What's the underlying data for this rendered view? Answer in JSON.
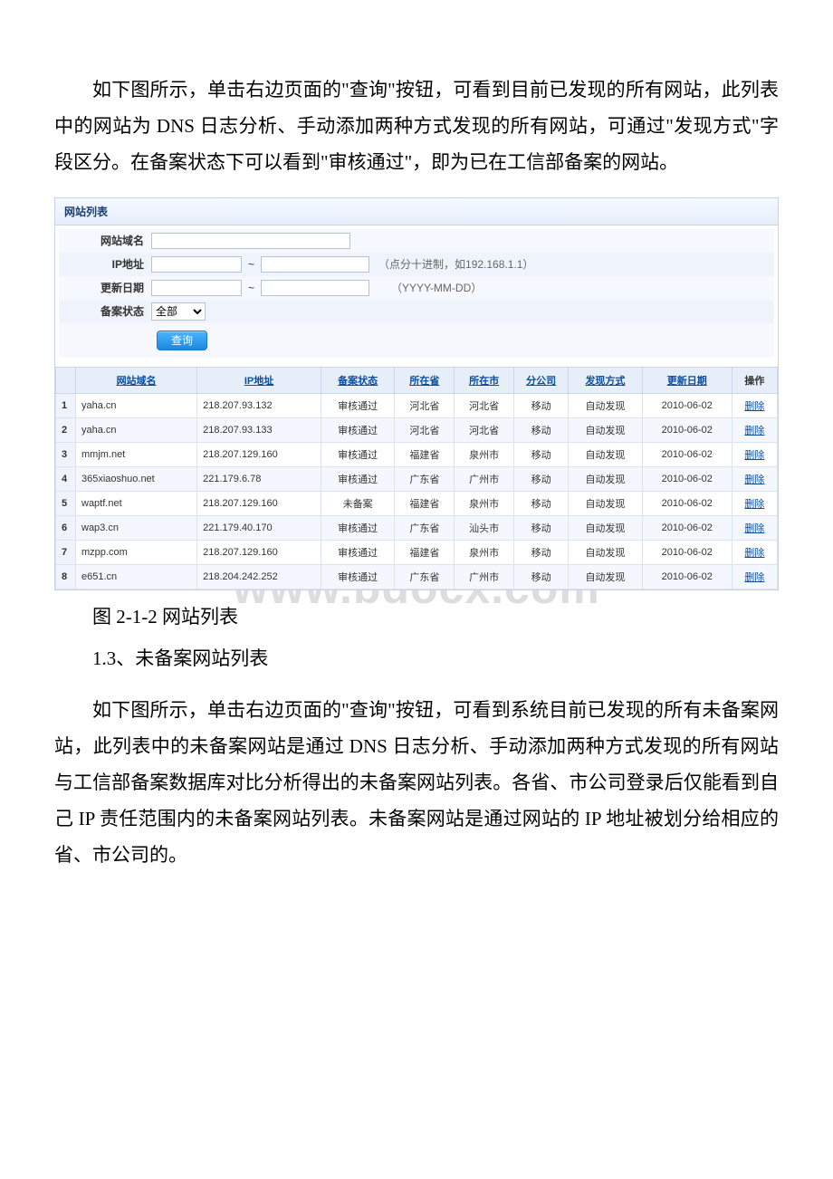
{
  "watermark": "www.bdocx.com",
  "para1": "如下图所示，单击右边页面的\"查询\"按钮，可看到目前已发现的所有网站，此列表中的网站为 DNS 日志分析、手动添加两种方式发现的所有网站，可通过\"发现方式\"字段区分。在备案状态下可以看到\"审核通过\"，即为已在工信部备案的网站。",
  "panel": {
    "title": "网站列表",
    "labels": {
      "domain": "网站域名",
      "ip": "IP地址",
      "date": "更新日期",
      "status": "备案状态"
    },
    "status_selected": "全部",
    "hints": {
      "ip": "（点分十进制，如192.168.1.1）",
      "date": "（YYYY-MM-DD）"
    },
    "search_btn": "查询"
  },
  "table": {
    "headers": {
      "domain": "网站域名",
      "ip": "IP地址",
      "status": "备案状态",
      "province": "所在省",
      "city": "所在市",
      "branch": "分公司",
      "method": "发现方式",
      "date": "更新日期",
      "op": "操作"
    },
    "rows": [
      {
        "idx": "1",
        "domain": "yaha.cn",
        "ip": "218.207.93.132",
        "status": "审核通过",
        "province": "河北省",
        "city": "河北省",
        "branch": "移动",
        "method": "自动发现",
        "date": "2010-06-02",
        "op": "删除"
      },
      {
        "idx": "2",
        "domain": "yaha.cn",
        "ip": "218.207.93.133",
        "status": "审核通过",
        "province": "河北省",
        "city": "河北省",
        "branch": "移动",
        "method": "自动发现",
        "date": "2010-06-02",
        "op": "删除"
      },
      {
        "idx": "3",
        "domain": "mmjm.net",
        "ip": "218.207.129.160",
        "status": "审核通过",
        "province": "福建省",
        "city": "泉州市",
        "branch": "移动",
        "method": "自动发现",
        "date": "2010-06-02",
        "op": "删除"
      },
      {
        "idx": "4",
        "domain": "365xiaoshuo.net",
        "ip": "221.179.6.78",
        "status": "审核通过",
        "province": "广东省",
        "city": "广州市",
        "branch": "移动",
        "method": "自动发现",
        "date": "2010-06-02",
        "op": "删除"
      },
      {
        "idx": "5",
        "domain": "waptf.net",
        "ip": "218.207.129.160",
        "status": "未备案",
        "province": "福建省",
        "city": "泉州市",
        "branch": "移动",
        "method": "自动发现",
        "date": "2010-06-02",
        "op": "删除"
      },
      {
        "idx": "6",
        "domain": "wap3.cn",
        "ip": "221.179.40.170",
        "status": "审核通过",
        "province": "广东省",
        "city": "汕头市",
        "branch": "移动",
        "method": "自动发现",
        "date": "2010-06-02",
        "op": "删除"
      },
      {
        "idx": "7",
        "domain": "mzpp.com",
        "ip": "218.207.129.160",
        "status": "审核通过",
        "province": "福建省",
        "city": "泉州市",
        "branch": "移动",
        "method": "自动发现",
        "date": "2010-06-02",
        "op": "删除"
      },
      {
        "idx": "8",
        "domain": "e651.cn",
        "ip": "218.204.242.252",
        "status": "审核通过",
        "province": "广东省",
        "city": "广州市",
        "branch": "移动",
        "method": "自动发现",
        "date": "2010-06-02",
        "op": "删除"
      }
    ]
  },
  "caption": "图 2-1-2 网站列表",
  "section_title": "1.3、未备案网站列表",
  "para2": "如下图所示，单击右边页面的\"查询\"按钮，可看到系统目前已发现的所有未备案网站，此列表中的未备案网站是通过 DNS 日志分析、手动添加两种方式发现的所有网站与工信部备案数据库对比分析得出的未备案网站列表。各省、市公司登录后仅能看到自己 IP 责任范围内的未备案网站列表。未备案网站是通过网站的 IP 地址被划分给相应的省、市公司的。"
}
